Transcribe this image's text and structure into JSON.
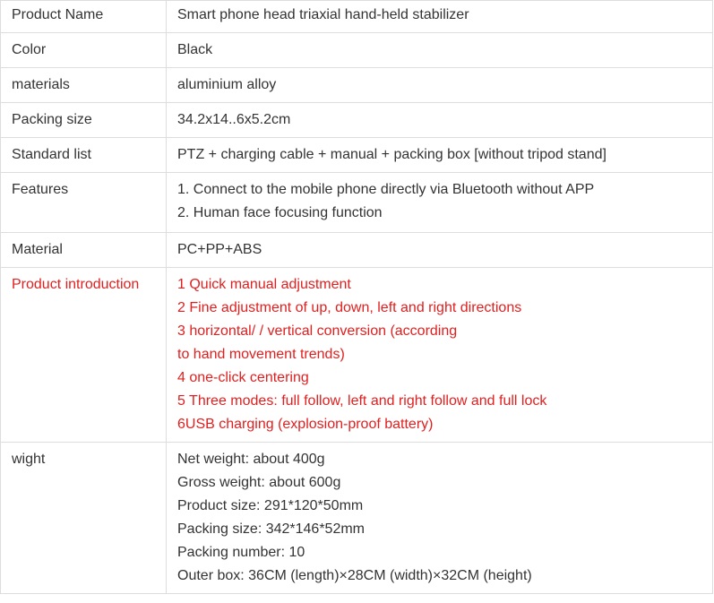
{
  "rows": [
    {
      "label": "Product Name",
      "lines": [
        "Smart phone head triaxial hand-held stabilizer"
      ]
    },
    {
      "label": "Color",
      "lines": [
        "Black"
      ]
    },
    {
      "label": "materials",
      "lines": [
        "aluminium alloy"
      ]
    },
    {
      "label": "Packing size",
      "lines": [
        "34.2x14..6x5.2cm"
      ]
    },
    {
      "label": "Standard list",
      "lines": [
        "PTZ + charging cable + manual + packing box [without tripod stand]"
      ]
    },
    {
      "label": "Features",
      "lines": [
        "1. Connect to the mobile phone directly via Bluetooth without APP",
        "2. Human face focusing function"
      ]
    },
    {
      "label": "Material",
      "lines": [
        "PC+PP+ABS"
      ]
    },
    {
      "label": "Product introduction",
      "lines": [
        "1 Quick manual adjustment",
        "2 Fine adjustment of up, down, left and right directions",
        "3 horizontal/ / vertical conversion (according",
        "to hand movement trends)",
        "4 one-click centering",
        "5 Three modes: full follow, left and right follow and full lock",
        "6USB charging (explosion-proof battery)"
      ]
    },
    {
      "label": "wight",
      "lines": [
        "Net weight: about 400g",
        "Gross weight: about 600g",
        "Product size: 291*120*50mm",
        "Packing size: 342*146*52mm",
        "Packing number: 10",
        "Outer box: 36CM (length)×28CM (width)×32CM (height)"
      ]
    }
  ],
  "colors": {
    "text": "#333333",
    "highlight": "#e02020",
    "border": "#dddddd"
  }
}
